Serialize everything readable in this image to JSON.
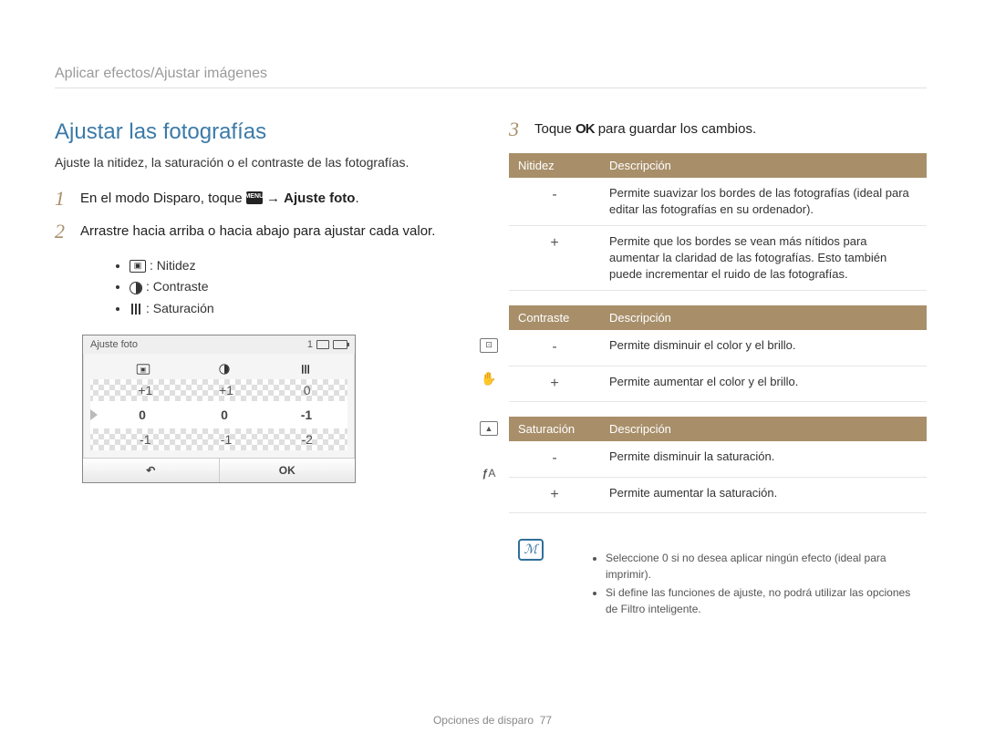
{
  "breadcrumb": "Aplicar efectos/Ajustar imágenes",
  "title": "Ajustar las fotografías",
  "intro": "Ajuste la nitidez, la saturación o el contraste de las fotografías.",
  "steps": {
    "s1_pre": "En el modo Disparo, toque ",
    "s1_menu": "MENU",
    "s1_post_arrow": " → ",
    "s1_bold": "Ajuste foto",
    "s1_end": ".",
    "s2": "Arrastre hacia arriba o hacia abajo para ajustar cada valor.",
    "s3_pre": "Toque ",
    "s3_ok": "OK",
    "s3_post": " para guardar los cambios."
  },
  "bullets": {
    "b1": ": Nitidez",
    "b2": ": Contraste",
    "b3": ": Saturación"
  },
  "lcd": {
    "title": "Ajuste foto",
    "row_top": [
      "+1",
      "+1",
      "0"
    ],
    "row_mid": [
      "0",
      "0",
      "-1"
    ],
    "row_bot": [
      "-1",
      "-1",
      "-2"
    ],
    "back": "↶",
    "ok": "OK",
    "corner": "1"
  },
  "tables": {
    "t1": {
      "h1": "Nitidez",
      "h2": "Descripción",
      "r1s": "-",
      "r1d": "Permite suavizar los bordes de las fotografías (ideal para editar las fotografías en su ordenador).",
      "r2s": "+",
      "r2d": "Permite que los bordes se vean más nítidos para aumentar la claridad de las fotografías. Esto también puede incrementar el ruido de las fotografías."
    },
    "t2": {
      "h1": "Contraste",
      "h2": "Descripción",
      "r1s": "-",
      "r1d": "Permite disminuir el color y el brillo.",
      "r2s": "+",
      "r2d": "Permite aumentar el color y el brillo."
    },
    "t3": {
      "h1": "Saturación",
      "h2": "Descripción",
      "r1s": "-",
      "r1d": "Permite disminuir la saturación.",
      "r2s": "+",
      "r2d": "Permite aumentar la saturación."
    }
  },
  "notes": {
    "n1": "Seleccione 0 si no desea aplicar ningún efecto (ideal para imprimir).",
    "n2": "Si define las funciones de ajuste, no podrá utilizar las opciones de Filtro inteligente."
  },
  "footer": {
    "section": "Opciones de disparo",
    "page": "77"
  }
}
